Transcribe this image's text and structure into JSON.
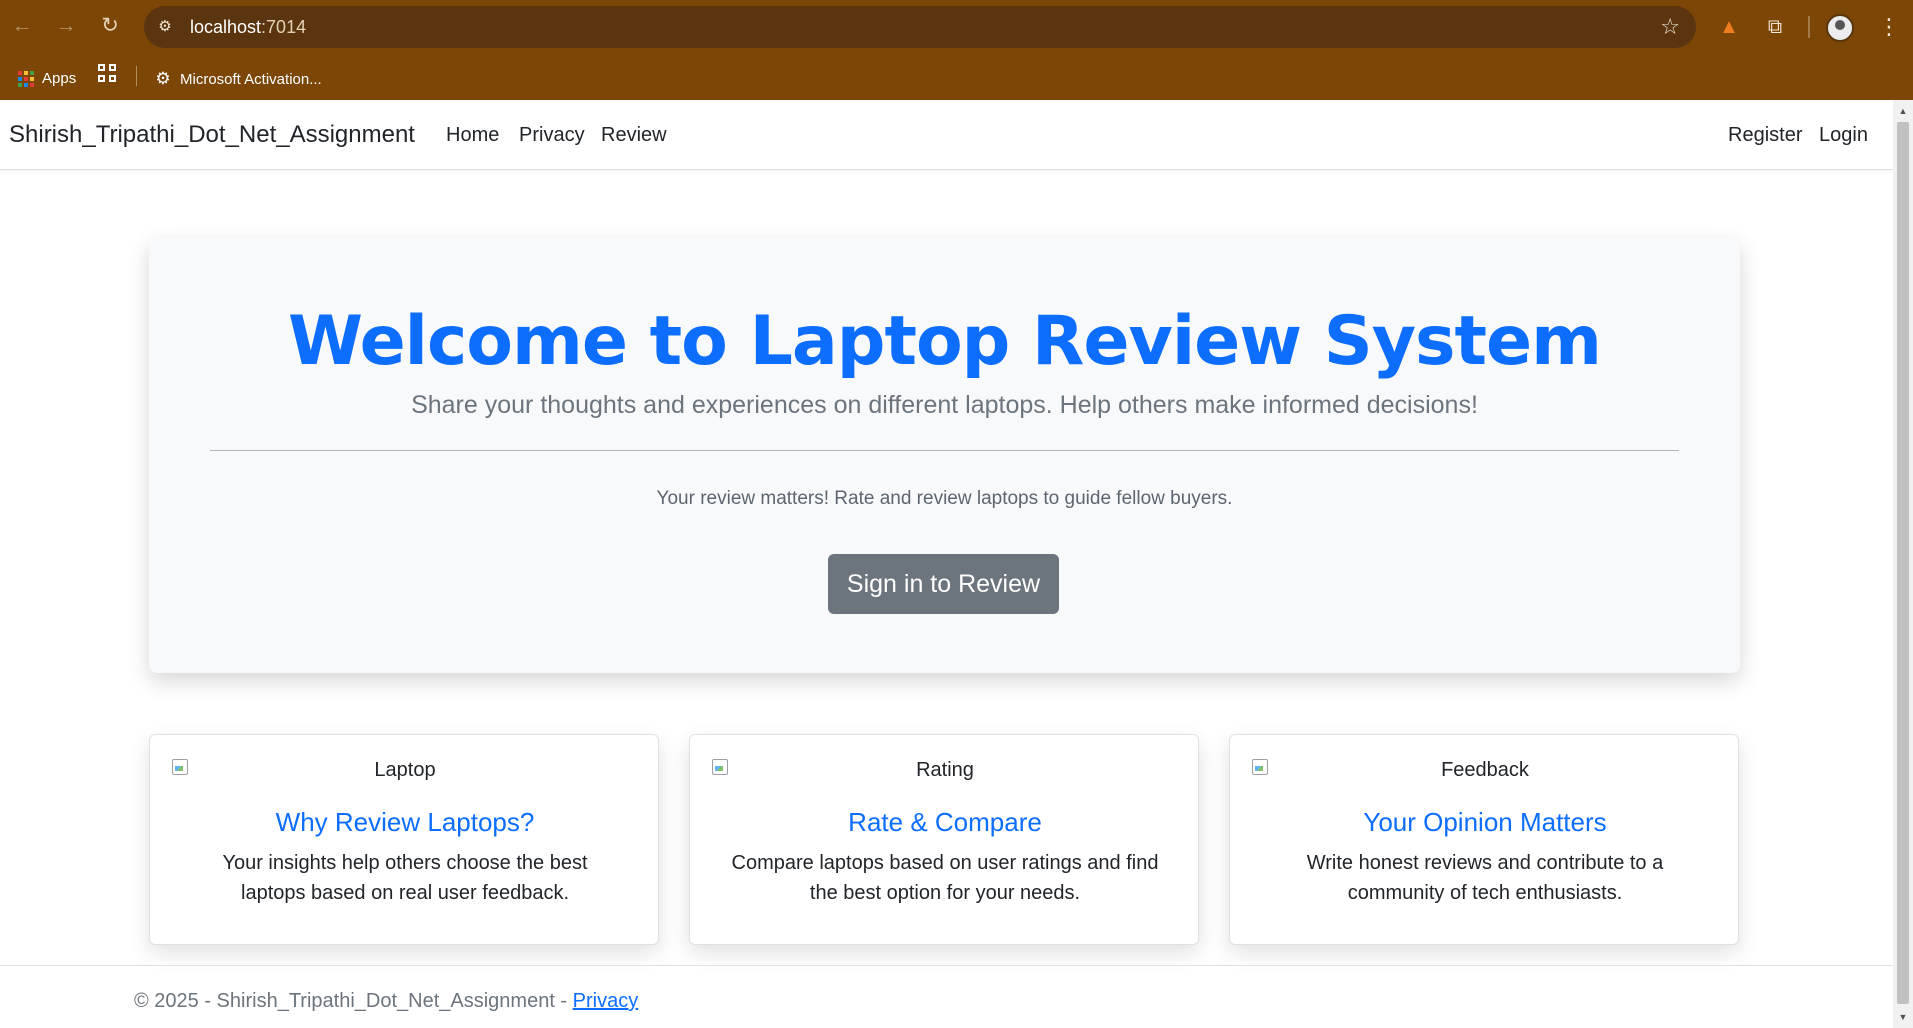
{
  "browser": {
    "url_host": "localhost",
    "url_port": ":7014",
    "bookmarks": {
      "apps_label": "Apps",
      "microsoft_label": "Microsoft Activation..."
    }
  },
  "navbar": {
    "brand": "Shirish_Tripathi_Dot_Net_Assignment",
    "links": [
      "Home",
      "Privacy",
      "Review"
    ],
    "register": "Register",
    "login": "Login"
  },
  "hero": {
    "title": "Welcome to Laptop Review System",
    "lead": "Share your thoughts and experiences on different laptops. Help others make informed decisions!",
    "note": "Your review matters! Rate and review laptops to guide fellow buyers.",
    "button": "Sign in to Review"
  },
  "cards": [
    {
      "img_alt": "Laptop",
      "title": "Why Review Laptops?",
      "text": "Your insights help others choose the best laptops based on real user feedback."
    },
    {
      "img_alt": "Rating",
      "title": "Rate & Compare",
      "text": "Compare laptops based on user ratings and find the best option for your needs."
    },
    {
      "img_alt": "Feedback",
      "title": "Your Opinion Matters",
      "text": "Write honest reviews and contribute to a community of tech enthusiasts."
    }
  ],
  "footer": {
    "text": "© 2025 - Shirish_Tripathi_Dot_Net_Assignment - ",
    "privacy_link": "Privacy"
  },
  "colors": {
    "browser_frame": "#7b4606",
    "primary": "#0d6efd",
    "button": "#6c757d",
    "hero_bg": "#f8f9fa"
  }
}
